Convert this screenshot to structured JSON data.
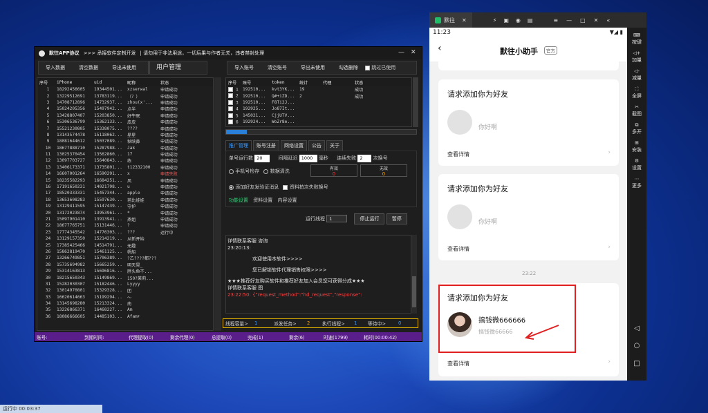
{
  "app": {
    "title": "默往APP协议",
    "subtitle": ">>> 承接软件定制开发",
    "notice": "| 请勿用于非法用途，一切后果与作者无关，违者禁封处理",
    "toolbar_left": [
      "导入数据",
      "清空数据",
      "导出未使用"
    ],
    "user_manage": "用户管理",
    "toolbar_right": [
      "导入账号",
      "清空账号",
      "导出未使用",
      "勾选删除"
    ],
    "skip_used": "跳过已使用",
    "left_columns": [
      "序号",
      "iPhone",
      "uid",
      "昵称",
      "状态"
    ],
    "left_rows": [
      [
        "1",
        "18292456605",
        "19344501...",
        "xzserwal",
        "申请成功"
      ],
      [
        "2",
        "13229512691",
        "13783119...",
        "（？）",
        "申请成功"
      ],
      [
        "3",
        "14708712896",
        "14732937...",
        "zhou(x'...",
        "申请成功"
      ],
      [
        "4",
        "15024205356",
        "15497942...",
        "点半",
        "申请成功"
      ],
      [
        "5",
        "13428807407",
        "15203850...",
        "好牛眠",
        "申请成功"
      ],
      [
        "6",
        "15306536799",
        "15362133...",
        "皮皮",
        "申请成功"
      ],
      [
        "7",
        "15521230805",
        "15338075...",
        "????",
        "申请成功"
      ],
      [
        "8",
        "13143574478",
        "15118062...",
        "星星",
        "申请成功"
      ],
      [
        "9",
        "18081644612",
        "15037089...",
        "秋映鼻",
        "申请成功"
      ],
      [
        "10",
        "18677888710",
        "15287988...",
        "Jak",
        "申请成功"
      ],
      [
        "11",
        "13025370454",
        "13562860...",
        "17",
        "申请成功"
      ],
      [
        "12",
        "13097703727",
        "15640843...",
        "练",
        "申请成功"
      ],
      [
        "13",
        "13406173371",
        "13735801...",
        "t12332100",
        "申请成功"
      ],
      [
        "14",
        "16607001264",
        "16590291...",
        "x",
        "申请失败"
      ],
      [
        "15",
        "18235582293",
        "16684251...",
        "风",
        "申请成功"
      ],
      [
        "16",
        "17191650231",
        "14021798...",
        "u",
        "申请成功"
      ],
      [
        "17",
        "18520333331",
        "15457344...",
        "apple",
        "申请成功"
      ],
      [
        "18",
        "13653608283",
        "15597630...",
        "芭比娃娃",
        "申请成功"
      ],
      [
        "19",
        "13129411595",
        "15147439...",
        "守护",
        "申请成功"
      ],
      [
        "20",
        "13172023874",
        "13953961...",
        "*",
        "申请成功"
      ],
      [
        "21",
        "15097901410",
        "13913941...",
        "燕姐",
        "申请成功"
      ],
      [
        "22",
        "18677765751",
        "15131446...",
        "?",
        "申请成功"
      ],
      [
        "23",
        "17774345542",
        "14776303...",
        "???",
        "运行中"
      ],
      [
        "24",
        "13129157350",
        "15214219...",
        "从新开始",
        ""
      ],
      [
        "25",
        "17385425466",
        "14514791...",
        "无趣",
        ""
      ],
      [
        "26",
        "15862819470",
        "15461125...",
        "帆船",
        ""
      ],
      [
        "27",
        "13266749851",
        "15706389...",
        "?乙????都???",
        ""
      ],
      [
        "28",
        "15735694982",
        "15665259...",
        "明天晃_",
        ""
      ],
      [
        "29",
        "15314163813",
        "15696816...",
        "胖头鱼不...",
        ""
      ],
      [
        "30",
        "18215650343",
        "15149869...",
        "150?莱莉...",
        ""
      ],
      [
        "31",
        "15282030307",
        "15182446...",
        "Lyyyy",
        ""
      ],
      [
        "32",
        "13014970801",
        "15329328...",
        "团",
        ""
      ],
      [
        "33",
        "16620614663",
        "15199294...",
        "～",
        ""
      ],
      [
        "34",
        "13145698280",
        "15213324...",
        "南",
        ""
      ],
      [
        "35",
        "13226866371",
        "16468227...",
        "Am",
        ""
      ],
      [
        "36",
        "18086666605",
        "14485103...",
        "Afam+",
        ""
      ]
    ],
    "right_columns": [
      "序号",
      "账号",
      "token",
      "统计",
      "代理",
      "状态"
    ],
    "right_rows": [
      [
        "1",
        "192510...",
        "kvt3YK...",
        "19",
        "",
        "成功"
      ],
      [
        "2",
        "192510...",
        "Q#+iZD...",
        "2",
        "",
        "成功"
      ],
      [
        "3",
        "192510...",
        "F8Ti2J...",
        "",
        "",
        ""
      ],
      [
        "4",
        "192925...",
        "Jo87It...",
        "",
        "",
        ""
      ],
      [
        "5",
        "145021...",
        "CjjUTV...",
        "",
        "",
        ""
      ],
      [
        "6",
        "192924...",
        "WoZr8e...",
        "",
        "",
        ""
      ]
    ],
    "tabs": [
      "推广管理",
      "账号注册",
      "网络设置",
      "公告",
      "关于"
    ],
    "single_threads_label": "单号运行数",
    "single_threads": "20",
    "interval_label": "间隔延迟",
    "interval": "1000",
    "ms": "毫秒",
    "fail_label": "连续失败",
    "fail": "2",
    "switch": "次换号",
    "radio_phone": "手机号检存",
    "radio_data": "数据清洗",
    "valid_label": "有效",
    "valid": "0",
    "invalid_label": "无效",
    "invalid": "0",
    "radio_add": "添加好友发验证消息",
    "chk_fail": "资料拍次失败换号",
    "sub_tabs": [
      "功能设置",
      "资料设置",
      "内容设置"
    ],
    "run_threads_label": "运行线程",
    "run_threads": "1",
    "stop_btn": "停止运行",
    "pause_btn": "暂停",
    "log": [
      "详情联系客服  咨询",
      "23:20:13:",
      "",
      "欢迎使用本软件>>>>",
      "",
      "您已解锁软件代理销售权限>>>>",
      "",
      "★★★推荐好友购买软件和推荐好友加入会员您可获得分成★★★",
      "详情联系客服  图",
      "23:22:50: {\"request_method\":\"hd_request\",\"response\":"
    ],
    "bottom_stats": [
      {
        "label": "线程容量>",
        "value": "1"
      },
      {
        "label": "派发任务>",
        "value": "2"
      },
      {
        "label": "执行线程>",
        "value": "1"
      },
      {
        "label": "等待中>",
        "value": "0"
      }
    ],
    "status": [
      "账号:",
      "到期时间:",
      "代理提取(0)",
      "剩余代理(0)",
      "总提取(0)",
      "完成(1)",
      "剩余(6)",
      "时速(1799)",
      "耗时(00:00:42)"
    ]
  },
  "emulator": {
    "tab_name": "默往",
    "time": "11:23",
    "side_items": [
      "按键",
      "加量",
      "减量",
      "全屏",
      "截图",
      "多开",
      "安装",
      "设置",
      "更多"
    ],
    "header_title": "默往小助手",
    "official_badge": "官方",
    "cards": [
      {
        "title": "请求添加你为好友",
        "name": "",
        "msg": "你好啊",
        "detail": "查看详情"
      },
      {
        "title": "请求添加你为好友",
        "name": "",
        "msg": "你好啊",
        "detail": "查看详情"
      },
      {
        "title": "请求添加你为好友",
        "name": "搞钱微666666",
        "msg": "搞钱微66666",
        "detail": "查看详情"
      }
    ],
    "timestamp": "23:22"
  },
  "taskbar_text": "运行中 00:03:37",
  "colors": {
    "accent_blue": "#3c9bff",
    "statusbar": "#5a1e8a",
    "highlight_red": "#e02020"
  }
}
